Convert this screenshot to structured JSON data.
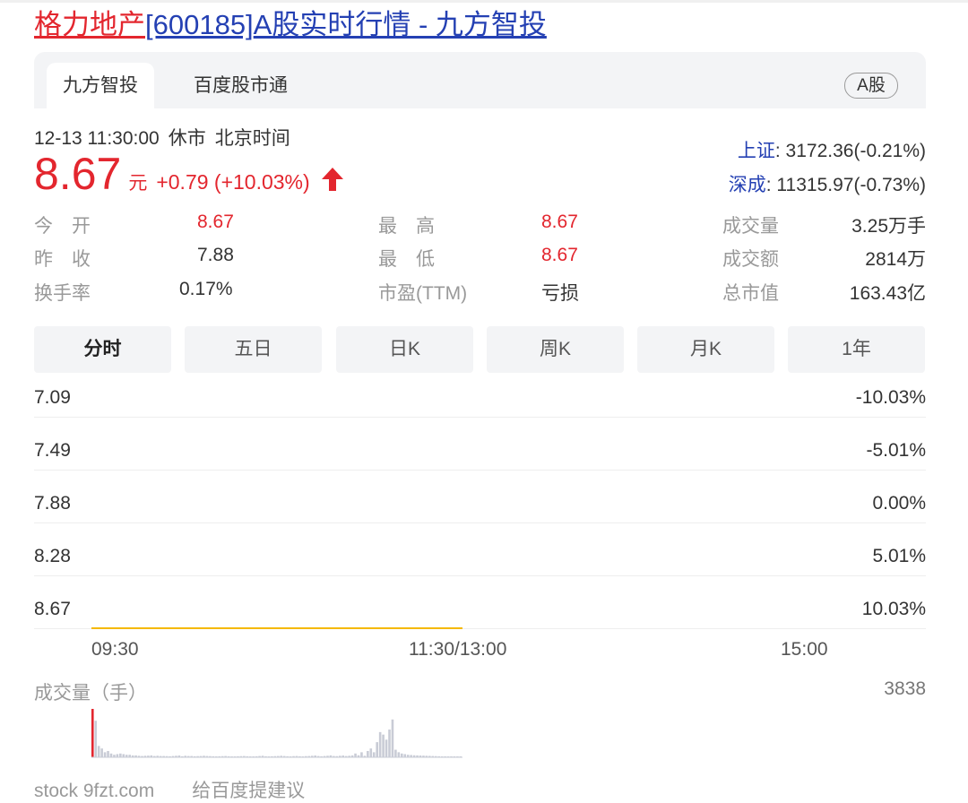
{
  "title": {
    "stock_name": "格力地产",
    "code": "[600185]",
    "rest": "A股实时行情 - 九方智投"
  },
  "tabs": {
    "active": "九方智投",
    "second": "百度股市通",
    "badge": "A股"
  },
  "status": {
    "time": "12-13 11:30:00",
    "state": "休市",
    "zone": "北京时间"
  },
  "quote": {
    "price": "8.67",
    "unit": "元",
    "change": "+0.79 (+10.03%)"
  },
  "indices": [
    {
      "name": "上证",
      "value": ": 3172.36(-0.21%)"
    },
    {
      "name": "深成",
      "value": ": 11315.97(-0.73%)"
    }
  ],
  "stats": {
    "open": {
      "label": "今　开",
      "value": "8.67"
    },
    "prev_close": {
      "label": "昨　收",
      "value": "7.88"
    },
    "turnover": {
      "label": "换手率",
      "value": "0.17%"
    },
    "high": {
      "label": "最　高",
      "value": "8.67"
    },
    "low": {
      "label": "最　低",
      "value": "8.67"
    },
    "pe": {
      "label": "市盈(TTM)",
      "value": "亏损"
    },
    "volume": {
      "label": "成交量",
      "value": "3.25万手"
    },
    "amount": {
      "label": "成交额",
      "value": "2814万"
    },
    "market_cap": {
      "label": "总市值",
      "value": "163.43亿"
    }
  },
  "period_tabs": [
    "分时",
    "五日",
    "日K",
    "周K",
    "月K",
    "1年"
  ],
  "colors": {
    "up": "#e3262e",
    "link": "#2440b3",
    "price_line": "#f5b800",
    "volume_bar": "#c9ccd6",
    "volume_highlight": "#e3262e"
  },
  "chart_data": {
    "type": "line",
    "price_levels": [
      "7.09",
      "7.49",
      "7.88",
      "8.28",
      "8.67"
    ],
    "pct_levels": [
      "-10.03%",
      "-5.01%",
      "0.00%",
      "5.01%",
      "10.03%"
    ],
    "x_labels": [
      "09:30",
      "11:30/13:00",
      "15:00"
    ],
    "session_minutes": 240,
    "elapsed_minutes": 120,
    "price_series": {
      "start_minute": 0,
      "end_minute": 120,
      "value": 8.67
    },
    "volume_label": "成交量（手）",
    "volume_max_label": "3838",
    "volume_max": 3838,
    "volume": [
      3838,
      2900,
      900,
      700,
      400,
      500,
      300,
      200,
      250,
      300,
      250,
      200,
      200,
      150,
      150,
      120,
      100,
      120,
      130,
      150,
      100,
      120,
      100,
      100,
      90,
      80,
      100,
      120,
      140,
      80,
      120,
      100,
      100,
      80,
      90,
      100,
      120,
      100,
      90,
      80,
      70,
      80,
      90,
      100,
      80,
      70,
      60,
      80,
      90,
      100,
      80,
      70,
      60,
      80,
      100,
      120,
      80,
      70,
      80,
      90,
      100,
      120,
      100,
      80,
      70,
      90,
      100,
      80,
      70,
      90,
      100,
      120,
      140,
      100,
      80,
      100,
      120,
      150,
      100,
      90,
      120,
      140,
      100,
      120,
      150,
      300,
      160,
      400,
      120,
      500,
      700,
      400,
      1200,
      2000,
      1800,
      1400,
      2200,
      3000,
      600,
      400,
      300,
      250,
      200,
      180,
      160,
      150,
      140,
      130,
      120,
      110,
      100,
      90,
      80,
      70,
      60,
      60,
      50,
      50,
      40,
      40
    ]
  },
  "footer": {
    "text": "stock 9fzt.com　　给百度提建议"
  }
}
